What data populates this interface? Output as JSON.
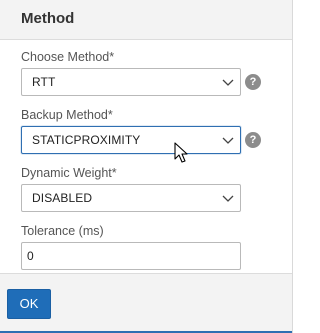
{
  "dialog": {
    "title": "Method"
  },
  "fields": {
    "choose_method": {
      "label": "Choose Method*",
      "value": "RTT",
      "help": "?"
    },
    "backup_method": {
      "label": "Backup Method*",
      "value": "STATICPROXIMITY",
      "help": "?"
    },
    "dynamic_weight": {
      "label": "Dynamic Weight*",
      "value": "DISABLED"
    },
    "tolerance": {
      "label": "Tolerance (ms)",
      "value": "0"
    }
  },
  "footer": {
    "ok_label": "OK"
  },
  "icons": {
    "dropdown": "chevron-down-icon",
    "help": "help-icon",
    "cursor": "mouse-pointer-icon"
  },
  "colors": {
    "accent": "#1f6db8",
    "focus_border": "#2f6fb2",
    "header_bg": "#f3f3f3",
    "help_icon": "#8c8c8c"
  }
}
